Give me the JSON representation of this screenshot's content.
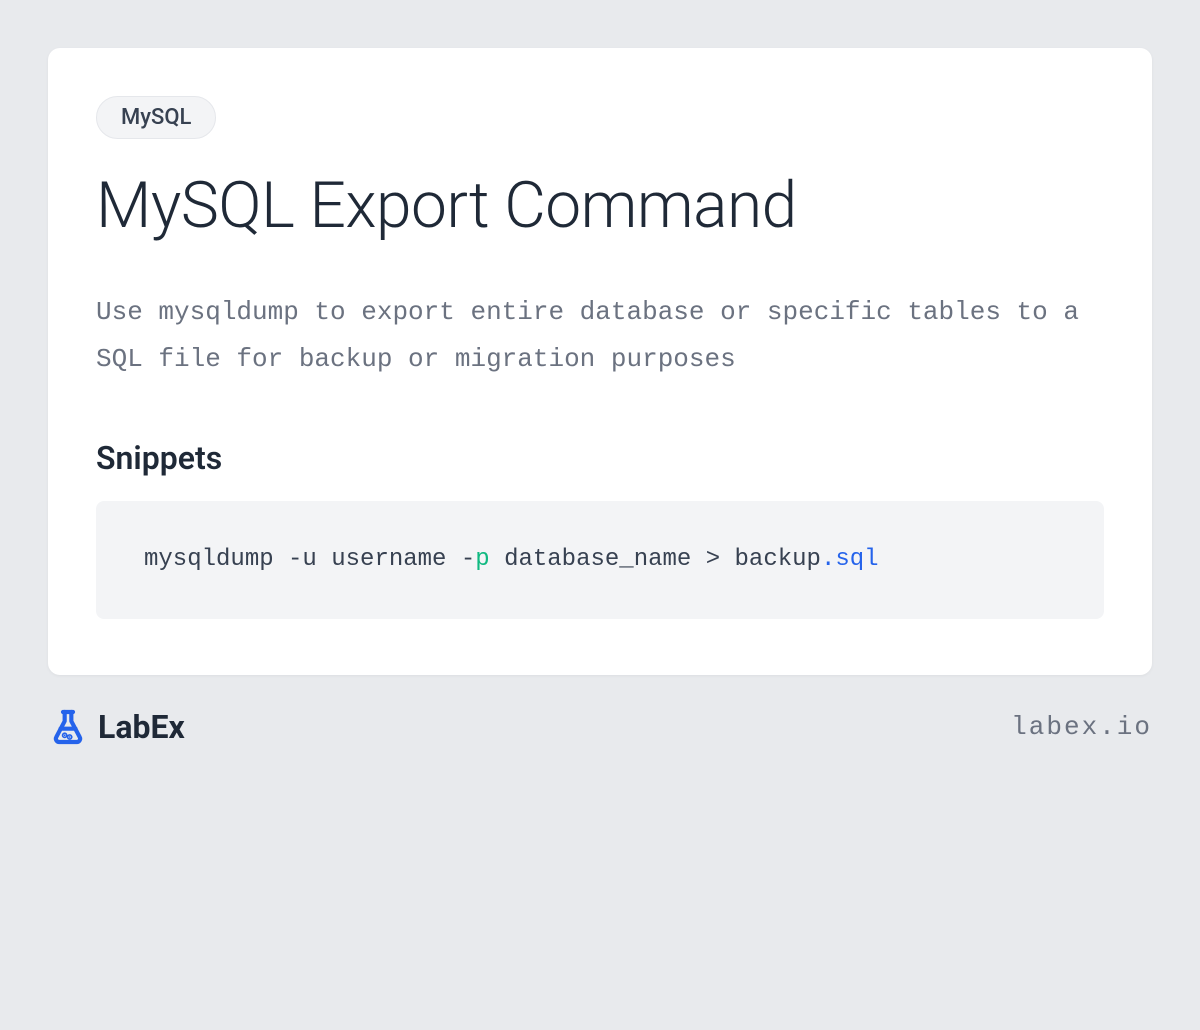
{
  "badge": "MySQL",
  "title": "MySQL Export Command",
  "description": "Use mysqldump to export entire database or specific tables to a SQL file for backup or migration purposes",
  "snippets_heading": "Snippets",
  "code": {
    "part1": "mysqldump -u username -",
    "part2_green": "p",
    "part3": " database_name > backup",
    "part4_blue": ".sql"
  },
  "footer": {
    "brand": "LabEx",
    "url": "labex.io"
  }
}
